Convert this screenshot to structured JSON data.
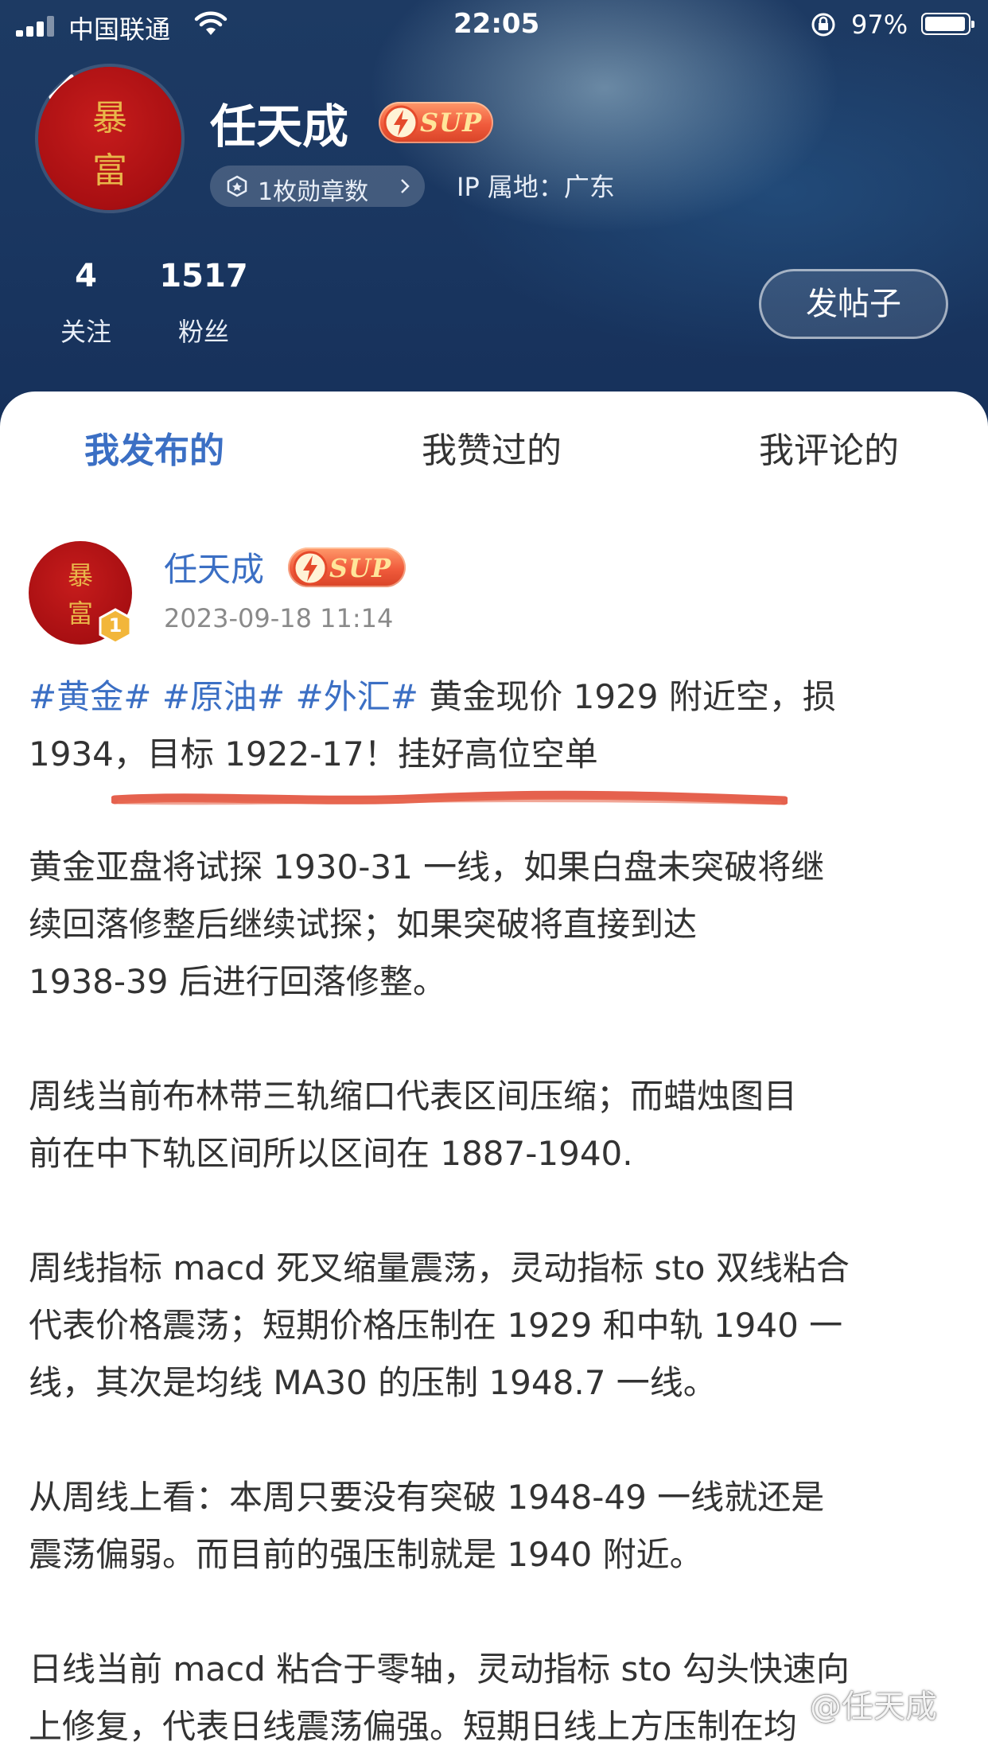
{
  "status_bar": {
    "carrier": "中国联通",
    "time": "22:05",
    "battery_percent": "97%"
  },
  "profile": {
    "avatar_text_top": "暴",
    "avatar_text_bottom": "富",
    "name": "任天成",
    "sup_badge": "SUP",
    "medals_label": "1枚勋章数",
    "ip_location": "IP 属地：广东",
    "following_count": "4",
    "following_label": "关注",
    "followers_count": "1517",
    "followers_label": "粉丝",
    "post_button": "发帖子"
  },
  "tabs": [
    {
      "label": "我发布的",
      "active": true
    },
    {
      "label": "我赞过的",
      "active": false
    },
    {
      "label": "我评论的",
      "active": false
    }
  ],
  "post": {
    "author": "任天成",
    "level": "1",
    "timestamp": "2023-09-18 11:14",
    "tags": [
      "#黄金#",
      "#原油#",
      "#外汇#"
    ],
    "lead_line1": " 黄金现价 1929 附近空，损",
    "lead_line2": "1934，目标 1922-17！挂好高位空单",
    "paragraphs": [
      "黄金亚盘将试探 1930-31 一线，如果白盘未突破将继\n续回落修整后继续试探；如果突破将直接到达\n1938-39 后进行回落修整。",
      "周线当前布林带三轨缩口代表区间压缩；而蜡烛图目\n前在中下轨区间所以区间在 1887-1940.",
      "周线指标 macd 死叉缩量震荡，灵动指标 sto 双线粘合\n代表价格震荡；短期价格压制在 1929 和中轨 1940 一\n线，其次是均线 MA30 的压制 1948.7 一线。",
      "从周线上看：本周只要没有突破 1948-49 一线就还是\n震荡偏弱。而目前的强压制就是 1940 附近。",
      "日线当前 macd 粘合于零轴，灵动指标 sto 勾头快速向\n上修复，代表日线震荡偏强。短期日线上方压制在均"
    ]
  },
  "watermark": "@任天成",
  "colors": {
    "accent_blue": "#3b6fc4",
    "header_navy": "#1a3761",
    "sup_orange": "#f05b3c",
    "underline_red": "#e0452f"
  }
}
